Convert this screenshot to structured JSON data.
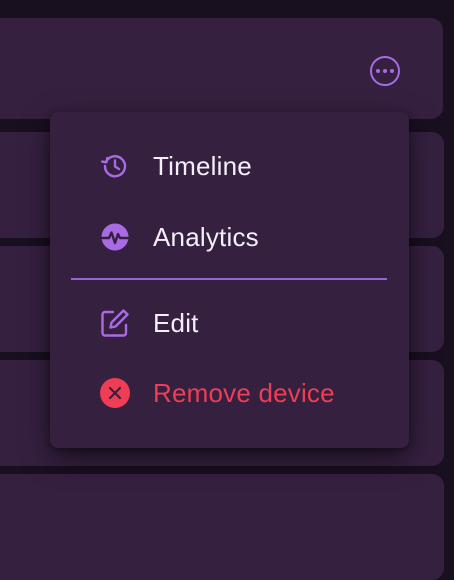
{
  "menu": {
    "items": [
      {
        "label": "Timeline",
        "icon": "history-icon"
      },
      {
        "label": "Analytics",
        "icon": "analytics-icon"
      },
      {
        "label": "Edit",
        "icon": "edit-icon"
      },
      {
        "label": "Remove device",
        "icon": "close-circle-icon"
      }
    ]
  },
  "colors": {
    "accent": "#a96be3",
    "danger": "#ee3d55",
    "surface": "#352040",
    "background": "#180f1f",
    "text": "#f4eef8"
  }
}
